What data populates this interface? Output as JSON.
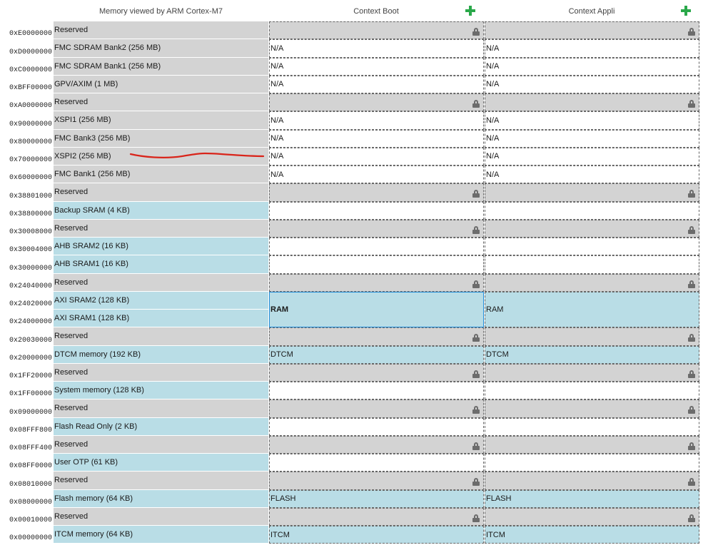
{
  "header": {
    "memory_title": "Memory viewed by ARM Cortex-M7",
    "context_boot": "Context Boot",
    "context_appli": "Context Appli"
  },
  "icons": {
    "add": "plus-icon",
    "lock": "lock-icon"
  },
  "colors": {
    "reserved": "#d3d3d3",
    "internal": "#b9dde6",
    "add": "#2aa84a",
    "selected_border": "#1f8ad6",
    "annotation": "#d9241a"
  },
  "rows": [
    {
      "addr": "0xE0000000",
      "label": "Reserved",
      "kind": "reserved",
      "boot": "",
      "appli": ""
    },
    {
      "addr": "0xD0000000",
      "label": "FMC SDRAM Bank2 (256 MB)",
      "kind": "ext",
      "boot": "N/A",
      "appli": "N/A"
    },
    {
      "addr": "0xC0000000",
      "label": "FMC SDRAM Bank1 (256 MB)",
      "kind": "ext",
      "boot": "N/A",
      "appli": "N/A"
    },
    {
      "addr": "0xBFF00000",
      "label": "GPV/AXIM (1 MB)",
      "kind": "ext",
      "boot": "N/A",
      "appli": "N/A"
    },
    {
      "addr": "0xA0000000",
      "label": "Reserved",
      "kind": "reserved",
      "boot": "",
      "appli": ""
    },
    {
      "addr": "0x90000000",
      "label": "XSPI1 (256 MB)",
      "kind": "ext",
      "boot": "N/A",
      "appli": "N/A"
    },
    {
      "addr": "0x80000000",
      "label": "FMC Bank3 (256 MB)",
      "kind": "ext",
      "boot": "N/A",
      "appli": "N/A"
    },
    {
      "addr": "0x70000000",
      "label": "XSPI2 (256 MB)",
      "kind": "ext",
      "boot": "N/A",
      "appli": "N/A"
    },
    {
      "addr": "0x60000000",
      "label": "FMC Bank1 (256 MB)",
      "kind": "ext",
      "boot": "N/A",
      "appli": "N/A"
    },
    {
      "addr": "0x38801000",
      "label": "Reserved",
      "kind": "reserved",
      "boot": "",
      "appli": ""
    },
    {
      "addr": "0x38800000",
      "label": "Backup SRAM (4 KB)",
      "kind": "int",
      "boot": "",
      "appli": ""
    },
    {
      "addr": "0x30008000",
      "label": "Reserved",
      "kind": "reserved",
      "boot": "",
      "appli": ""
    },
    {
      "addr": "0x30004000",
      "label": "AHB SRAM2 (16 KB)",
      "kind": "int",
      "boot": "",
      "appli": ""
    },
    {
      "addr": "0x30000000",
      "label": "AHB SRAM1 (16 KB)",
      "kind": "int",
      "boot": "",
      "appli": ""
    },
    {
      "addr": "0x24040000",
      "label": "Reserved",
      "kind": "reserved",
      "boot": "",
      "appli": ""
    },
    {
      "addr": "0x24020000",
      "label": "AXI SRAM2 (128 KB)",
      "kind": "int",
      "boot": "RAM",
      "appli": "RAM",
      "merge": 2,
      "selected": true
    },
    {
      "addr": "0x24000000",
      "label": "AXI SRAM1 (128 KB)",
      "kind": "int",
      "skip": true
    },
    {
      "addr": "0x20030000",
      "label": "Reserved",
      "kind": "reserved",
      "boot": "",
      "appli": ""
    },
    {
      "addr": "0x20000000",
      "label": "DTCM memory (192 KB)",
      "kind": "int",
      "boot": "DTCM",
      "appli": "DTCM"
    },
    {
      "addr": "0x1FF20000",
      "label": "Reserved",
      "kind": "reserved",
      "boot": "",
      "appli": ""
    },
    {
      "addr": "0x1FF00000",
      "label": "System memory (128 KB)",
      "kind": "int",
      "boot": "",
      "appli": ""
    },
    {
      "addr": "0x09000000",
      "label": "Reserved",
      "kind": "reserved",
      "boot": "",
      "appli": ""
    },
    {
      "addr": "0x08FFF800",
      "label": "Flash Read Only (2 KB)",
      "kind": "int",
      "boot": "",
      "appli": ""
    },
    {
      "addr": "0x08FFF400",
      "label": "Reserved",
      "kind": "reserved",
      "boot": "",
      "appli": ""
    },
    {
      "addr": "0x08FF0000",
      "label": "User OTP (61 KB)",
      "kind": "int",
      "boot": "",
      "appli": ""
    },
    {
      "addr": "0x08010000",
      "label": "Reserved",
      "kind": "reserved",
      "boot": "",
      "appli": ""
    },
    {
      "addr": "0x08000000",
      "label": "Flash memory (64 KB)",
      "kind": "int",
      "boot": "FLASH",
      "appli": "FLASH"
    },
    {
      "addr": "0x00010000",
      "label": "Reserved",
      "kind": "reserved",
      "boot": "",
      "appli": ""
    },
    {
      "addr": "0x00000000",
      "label": "ITCM memory (64 KB)",
      "kind": "int",
      "boot": "ITCM",
      "appli": "ITCM"
    }
  ]
}
